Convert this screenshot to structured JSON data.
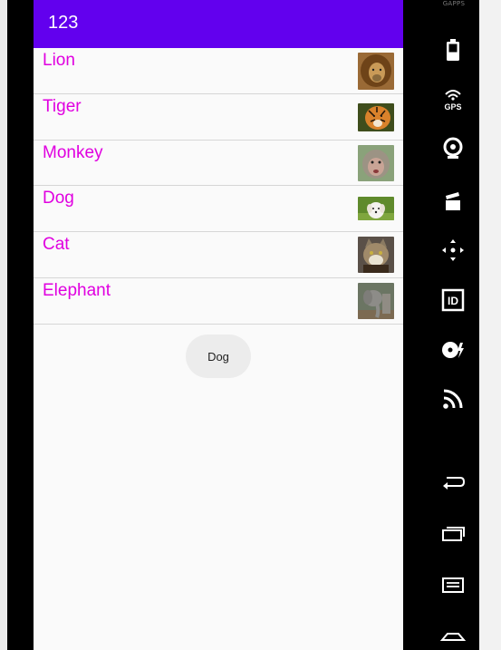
{
  "app": {
    "title": "123"
  },
  "animals": [
    {
      "label": "Lion",
      "thumb": "lion-photo"
    },
    {
      "label": "Tiger",
      "thumb": "tiger-photo"
    },
    {
      "label": "Monkey",
      "thumb": "monkey-photo"
    },
    {
      "label": "Dog",
      "thumb": "dog-photo"
    },
    {
      "label": "Cat",
      "thumb": "cat-photo"
    },
    {
      "label": "Elephant",
      "thumb": "elephant-photo"
    }
  ],
  "toast": {
    "text": "Dog"
  },
  "emulator": {
    "gapps_label": "GAPPS",
    "tools": [
      "battery-icon",
      "gps-icon",
      "camera-icon",
      "media-icon",
      "directional-pad-icon",
      "fingerprint-id-icon",
      "cd-icon",
      "broadcast-icon",
      "back-icon",
      "recent-apps-icon",
      "menu-icon",
      "home-icon"
    ]
  },
  "colors": {
    "appbar": "#6200ee",
    "label": "#e000e0",
    "toolbar": "#000000"
  }
}
